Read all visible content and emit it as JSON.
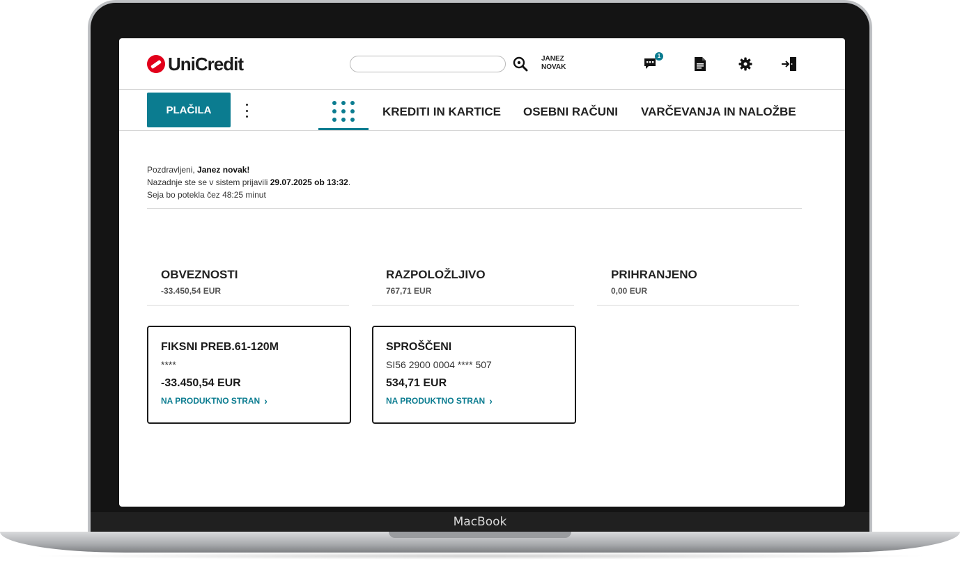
{
  "device": {
    "brand": "MacBook"
  },
  "header": {
    "logo_text": "UniCredit",
    "search": {
      "value": "",
      "placeholder": ""
    },
    "user": {
      "first_name": "JANEZ",
      "last_name": "NOVAK"
    },
    "messages_badge": "1",
    "icons": [
      "chat-icon",
      "document-icon",
      "gear-icon",
      "logout-icon"
    ]
  },
  "nav": {
    "primary_button": "PLAČILA",
    "tabs": [
      {
        "label": "KREDITI IN KARTICE"
      },
      {
        "label": "OSEBNI RAČUNI"
      },
      {
        "label": "VARČEVANJA IN NALOŽBE"
      }
    ]
  },
  "welcome": {
    "greeting_prefix": "Pozdravljeni, ",
    "name": "Janez novak!",
    "last_login_prefix": "Nazadnje ste se v sistem prijavili ",
    "last_login": "29.07.2025 ob 13:32",
    "last_login_suffix": ".",
    "session": "Seja bo potekla čez 48:25 minut"
  },
  "summary": [
    {
      "title": "OBVEZNOSTI",
      "value": "-33.450,54 EUR"
    },
    {
      "title": "RAZPOLOŽLJIVO",
      "value": "767,71 EUR"
    },
    {
      "title": "PRIHRANJENO",
      "value": "0,00 EUR"
    }
  ],
  "cards": [
    {
      "title": "FIKSNI PREB.61-120M",
      "sub": "****",
      "amount": "-33.450,54 EUR",
      "link": "NA PRODUKTNO STRAN"
    },
    {
      "title": "SPROŠČENI",
      "sub": "SI56 2900 0004 **** 507",
      "amount": "534,71 EUR",
      "link": "NA PRODUKTNO STRAN"
    }
  ],
  "colors": {
    "accent": "#0b7c90",
    "brand_red": "#e2001a"
  }
}
